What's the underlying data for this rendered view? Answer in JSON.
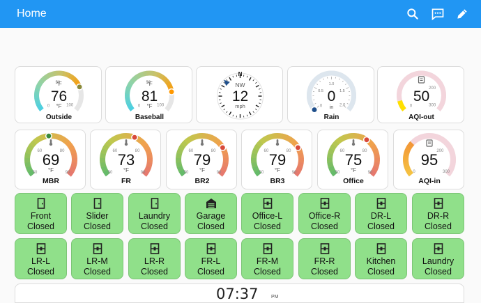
{
  "header": {
    "title": "Home",
    "search_icon": "search-icon",
    "assist_icon": "assist-icon",
    "edit_icon": "pencil-icon"
  },
  "colors": {
    "header": "#2196f3",
    "closed": "#90e08a",
    "cool": "#4dd0e1",
    "warm": "#ff9800",
    "hot": "#e57373",
    "ok": "#66bb6a"
  },
  "gauges_top": [
    {
      "name": "Outside",
      "value": "76",
      "unit": "°F",
      "unit2": "°F",
      "min": "0",
      "max": "100",
      "mid": "50",
      "fraction": 0.76
    },
    {
      "name": "Baseball",
      "value": "81",
      "unit": "°F",
      "unit2": "°F",
      "min": "0",
      "max": "100",
      "mid": "50",
      "fraction": 0.81
    },
    {
      "name": "Wind",
      "value": "12",
      "direction": "NW",
      "north": "N",
      "unit": "mph",
      "heading_deg": 315
    },
    {
      "name": "Rain",
      "value": "0",
      "unit": "in",
      "min": "0",
      "max": "2.0",
      "ticks": [
        "0.5",
        "1.0",
        "1.5"
      ],
      "fraction": 0.0
    },
    {
      "name": "AQI-out",
      "value": "50",
      "min": "0",
      "max": "300",
      "mid": "200",
      "fraction": 0.17
    }
  ],
  "gauges_mid": [
    {
      "name": "MBR",
      "value": "69",
      "unit": "°F",
      "min": "50",
      "max": "90",
      "tick1": "60",
      "tick2": "80",
      "fraction": 0.48
    },
    {
      "name": "FR",
      "value": "73",
      "unit": "°F",
      "min": "50",
      "max": "90",
      "tick1": "60",
      "tick2": "80",
      "fraction": 0.58
    },
    {
      "name": "BR2",
      "value": "79",
      "unit": "°F",
      "min": "50",
      "max": "90",
      "tick1": "60",
      "tick2": "80",
      "fraction": 0.73
    },
    {
      "name": "BR3",
      "value": "79",
      "unit": "°F",
      "min": "50",
      "max": "90",
      "tick1": "60",
      "tick2": "80",
      "fraction": 0.73
    },
    {
      "name": "Office",
      "value": "75",
      "unit": "°F",
      "min": "50",
      "max": "90",
      "tick1": "60",
      "tick2": "80",
      "fraction": 0.63
    },
    {
      "name": "AQI-in",
      "value": "95",
      "min": "0",
      "max": "300",
      "mid": "200",
      "fraction": 0.32
    }
  ],
  "devices_row1": [
    {
      "name": "Front",
      "state": "Closed",
      "icon": "door-closed-icon"
    },
    {
      "name": "Slider",
      "state": "Closed",
      "icon": "door-closed-icon"
    },
    {
      "name": "Laundry",
      "state": "Closed",
      "icon": "door-closed-icon"
    },
    {
      "name": "Garage",
      "state": "Closed",
      "icon": "garage-icon"
    },
    {
      "name": "Office-L",
      "state": "Closed",
      "icon": "window-closed-icon"
    },
    {
      "name": "Office-R",
      "state": "Closed",
      "icon": "window-closed-icon"
    },
    {
      "name": "DR-L",
      "state": "Closed",
      "icon": "window-closed-icon"
    },
    {
      "name": "DR-R",
      "state": "Closed",
      "icon": "window-closed-icon"
    }
  ],
  "devices_row2": [
    {
      "name": "LR-L",
      "state": "Closed",
      "icon": "window-closed-icon"
    },
    {
      "name": "LR-M",
      "state": "Closed",
      "icon": "window-closed-icon"
    },
    {
      "name": "LR-R",
      "state": "Closed",
      "icon": "window-closed-icon"
    },
    {
      "name": "FR-L",
      "state": "Closed",
      "icon": "window-closed-icon"
    },
    {
      "name": "FR-M",
      "state": "Closed",
      "icon": "window-closed-icon"
    },
    {
      "name": "FR-R",
      "state": "Closed",
      "icon": "window-closed-icon"
    },
    {
      "name": "Kitchen",
      "state": "Closed",
      "icon": "window-closed-icon"
    },
    {
      "name": "Laundry",
      "state": "Closed",
      "icon": "window-closed-icon"
    }
  ],
  "clock": {
    "time": "07:37",
    "ampm": "PM"
  }
}
